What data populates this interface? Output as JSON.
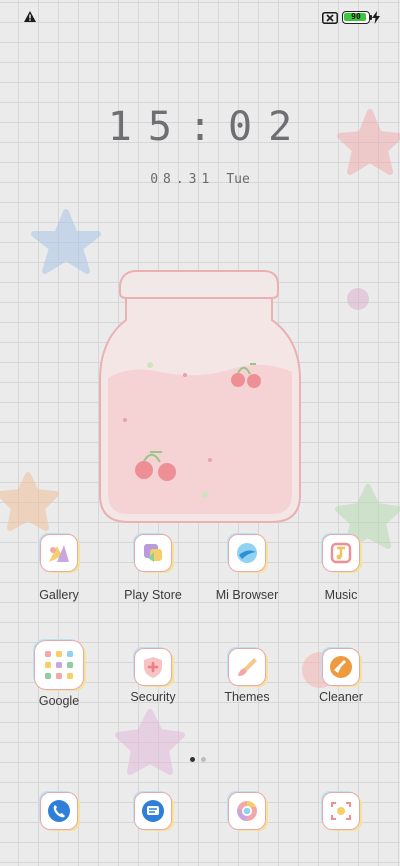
{
  "status_bar": {
    "battery_level": "90",
    "icons": [
      "warning-icon",
      "no-sim-icon",
      "battery-icon",
      "charging-icon"
    ]
  },
  "lockscreen": {
    "time": "15:02",
    "date": "08.31",
    "weekday": "Tue"
  },
  "apps_row1": [
    {
      "label": "Gallery",
      "icon": "gallery-icon"
    },
    {
      "label": "Play Store",
      "icon": "play-store-icon"
    },
    {
      "label": "Mi Browser",
      "icon": "mi-browser-icon"
    },
    {
      "label": "Music",
      "icon": "music-icon"
    }
  ],
  "apps_row2": [
    {
      "label": "Google",
      "icon": "google-folder-icon"
    },
    {
      "label": "Security",
      "icon": "security-icon"
    },
    {
      "label": "Themes",
      "icon": "themes-icon"
    },
    {
      "label": "Cleaner",
      "icon": "cleaner-icon"
    }
  ],
  "dock": [
    {
      "icon": "phone-icon"
    },
    {
      "icon": "messages-icon"
    },
    {
      "icon": "chrome-icon"
    },
    {
      "icon": "camera-icon"
    }
  ],
  "page_indicator": {
    "pages": 2,
    "current": 1
  },
  "colors": {
    "icon_border": "#e8a9ad",
    "battery": "#3fc63f",
    "clock": "#6f6e73"
  }
}
